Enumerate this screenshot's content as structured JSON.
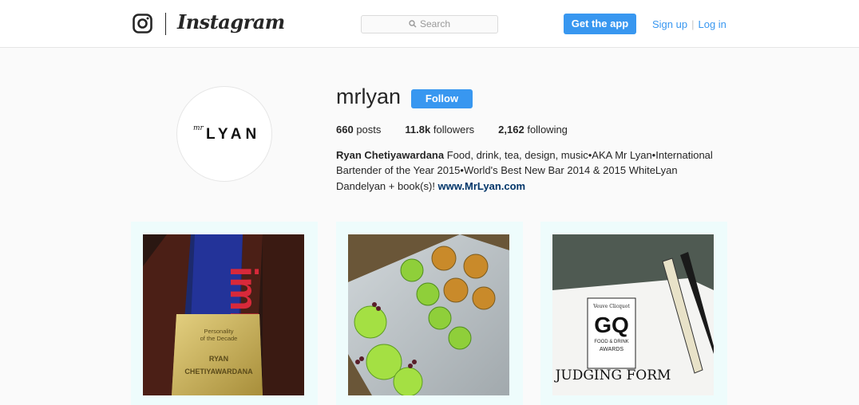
{
  "header": {
    "wordmark": "Instagram",
    "search_placeholder": "Search",
    "get_app_label": "Get the app",
    "signup_label": "Sign up",
    "separator": "|",
    "login_label": "Log in"
  },
  "profile": {
    "avatar_logo_small": "mr",
    "avatar_logo_big": "LYAN",
    "username": "mrlyan",
    "follow_label": "Follow",
    "stats": [
      {
        "value": "660",
        "label": "posts"
      },
      {
        "value": "11.8k",
        "label": "followers"
      },
      {
        "value": "2,162",
        "label": "following"
      }
    ],
    "bio": {
      "full_name": "Ryan Chetiyawardana",
      "text": " Food, drink, tea, design, music•AKA Mr Lyan•International Bartender of the Year 2015•World's Best New Bar 2014 & 2015 WhiteLyan Dandelyan + book(s)! ",
      "link": "www.MrLyan.com"
    }
  },
  "posts": [
    {
      "overlay_lines": [
        "Personality",
        "of the Decade",
        "RYAN",
        "CHETIYAWARDANA"
      ],
      "banner_text": "imbibe"
    },
    {
      "overlay_lines": []
    },
    {
      "overlay_lines": [
        "Veuve Clicquot",
        "GQ",
        "FOOD & DRINK",
        "AWARDS",
        "JUDGING FORM"
      ]
    }
  ],
  "colors": {
    "accent": "#3897f0",
    "link": "#003569",
    "frame": "#eefcfc"
  }
}
